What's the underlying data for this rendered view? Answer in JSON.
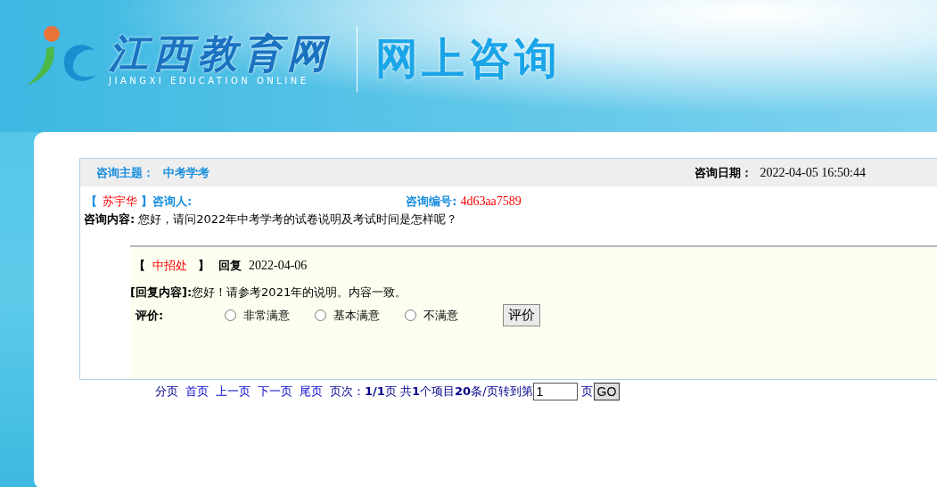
{
  "header": {
    "site_name": "江西教育网",
    "site_name_en": "JIANGXI EDUCATION ONLINE",
    "section_title": "网上咨询"
  },
  "consultation": {
    "topic_label": "咨询主题：",
    "topic": "中考学考",
    "date_label": "咨询日期：",
    "date": "2022-04-05 16:50:44",
    "bracket_open": "【",
    "asker": "苏宇华",
    "bracket_close": "】",
    "asker_label": "咨询人:",
    "number_label": "咨询编号:",
    "number": "4d63aa7589",
    "content_label": "咨询内容:",
    "content": "您好，请问2022年中考学考的试卷说明及考试时间是怎样呢？"
  },
  "reply": {
    "bracket_open": "【",
    "responder": "中招处",
    "bracket_close": "】",
    "reply_label": "回复",
    "reply_date": "2022-04-06",
    "content_label": "[回复内容]:",
    "content": "您好！请参考2021年的说明。内容一致。",
    "rating_label": "评价:",
    "rating_options": [
      {
        "label": "非常满意",
        "selected": false
      },
      {
        "label": "基本满意",
        "selected": false
      },
      {
        "label": "不满意",
        "selected": false
      }
    ],
    "rating_button": "评价"
  },
  "pager": {
    "prefix": "分页",
    "links": [
      "首页",
      "上一页",
      "下一页",
      "尾页"
    ],
    "summary": "页次：**1/1**页 共**1**个项目**20**条/页转到第",
    "page_input": "1",
    "suffix": "页",
    "go_button": "GO"
  }
}
